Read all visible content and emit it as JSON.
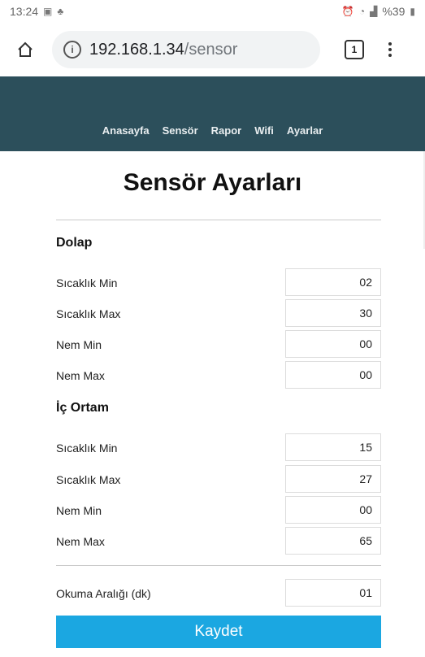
{
  "status": {
    "time": "13:24",
    "battery": "%39"
  },
  "browser": {
    "url_host": "192.168.1.34",
    "url_path": "/sensor",
    "tab_count": "1"
  },
  "nav": {
    "items": [
      "Anasayfa",
      "Sensör",
      "Rapor",
      "Wifi",
      "Ayarlar"
    ]
  },
  "page": {
    "title": "Sensör Ayarları"
  },
  "dolap": {
    "title": "Dolap",
    "rows": [
      {
        "label": "Sıcaklık Min",
        "value": "02"
      },
      {
        "label": "Sıcaklık Max",
        "value": "30"
      },
      {
        "label": "Nem Min",
        "value": "00"
      },
      {
        "label": "Nem Max",
        "value": "00"
      }
    ]
  },
  "ic_ortam": {
    "title": "İç Ortam",
    "rows": [
      {
        "label": "Sıcaklık Min",
        "value": "15"
      },
      {
        "label": "Sıcaklık Max",
        "value": "27"
      },
      {
        "label": "Nem Min",
        "value": "00"
      },
      {
        "label": "Nem Max",
        "value": "65"
      }
    ]
  },
  "interval": {
    "label": "Okuma Aralığı (dk)",
    "value": "01"
  },
  "save_label": "Kaydet",
  "colors": {
    "navbar": "#2c4f5b",
    "button": "#1ba7e1"
  }
}
